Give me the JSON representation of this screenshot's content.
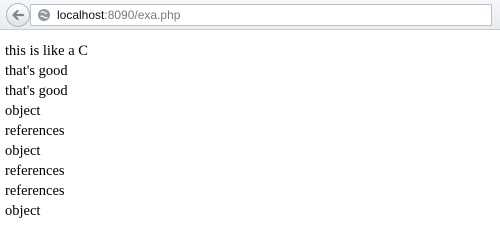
{
  "address_bar": {
    "host": "localhost",
    "rest": ":8090/exa.php"
  },
  "icons": {
    "back": "back-arrow-icon",
    "site": "globe-icon"
  },
  "output_lines": [
    "this is like a C",
    "that's good",
    "that's good",
    "object",
    "references",
    "object",
    "references",
    "references",
    "object"
  ]
}
